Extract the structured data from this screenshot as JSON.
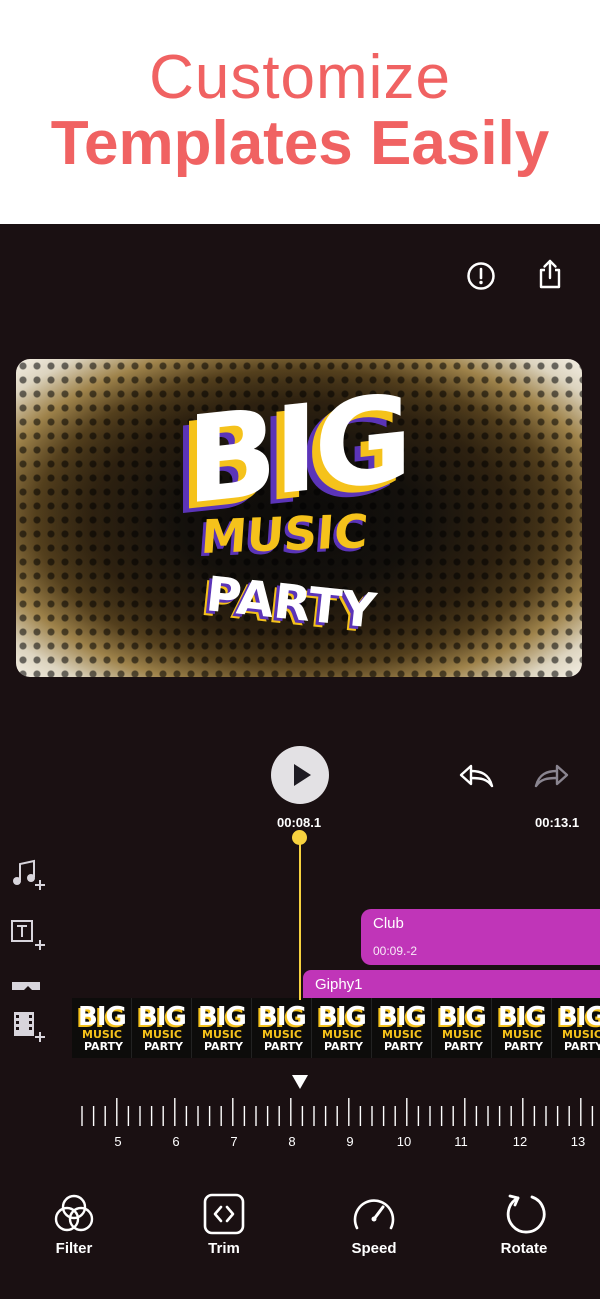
{
  "promo": {
    "line1": "Customize",
    "line2": "Templates Easily"
  },
  "header_icons": {
    "info": "alert-circle-icon",
    "share": "share-icon"
  },
  "preview": {
    "big": "BIG",
    "music": "MUSIC",
    "party": "PARTY"
  },
  "playback": {
    "current_time": "00:08.1",
    "end_time": "00:13.1"
  },
  "tracks": {
    "club": {
      "label": "Club",
      "time": "00:09.-2"
    },
    "giphy": {
      "label": "Giphy1"
    }
  },
  "filmstrip": {
    "thumbs": [
      {
        "big": "BIG",
        "music": "MUSIC",
        "party": "PARTY"
      },
      {
        "big": "BIG",
        "music": "MUSIC",
        "party": "PARTY"
      },
      {
        "big": "BIG",
        "music": "MUSIC",
        "party": "PARTY"
      },
      {
        "big": "BIG",
        "music": "MUSIC",
        "party": "PARTY"
      },
      {
        "big": "BIG",
        "music": "MUSIC",
        "party": "PARTY"
      },
      {
        "big": "BIG",
        "music": "MUSIC",
        "party": "PARTY"
      },
      {
        "big": "BIG",
        "music": "MUSIC",
        "party": "PARTY"
      },
      {
        "big": "BIG",
        "music": "MUSIC",
        "party": "PARTY"
      },
      {
        "big": "BIG",
        "music": "MUSIC",
        "party": "PARTY"
      }
    ]
  },
  "ruler": {
    "labels": [
      "5",
      "6",
      "7",
      "8",
      "9",
      "10",
      "11",
      "12",
      "13"
    ]
  },
  "tools": {
    "filter": "Filter",
    "trim": "Trim",
    "speed": "Speed",
    "rotate": "Rotate"
  },
  "colors": {
    "accent": "#f06262",
    "clip": "#c035b8",
    "playhead": "#f7d23f",
    "background": "#1a1012"
  }
}
